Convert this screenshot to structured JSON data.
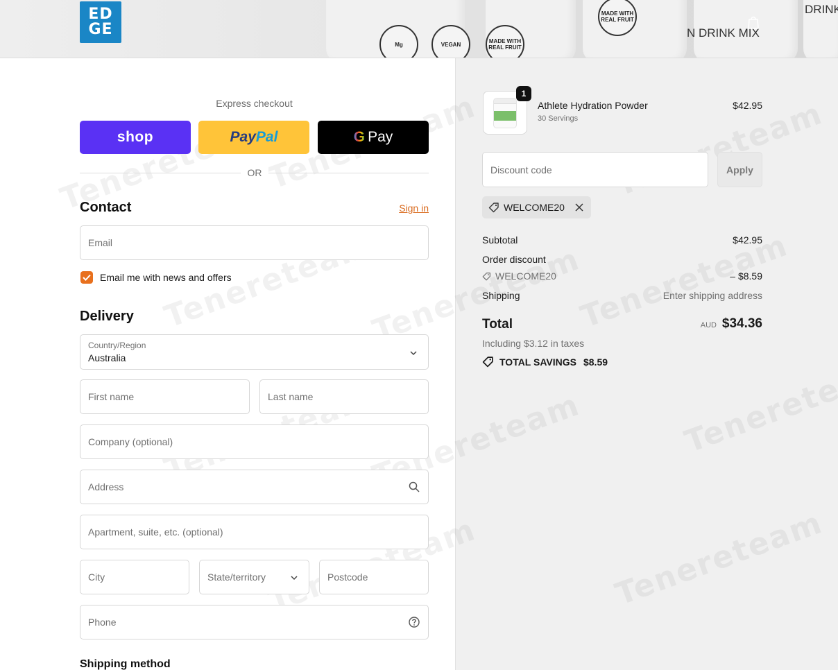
{
  "header": {
    "logo_top": "ED",
    "logo_bottom": "GE",
    "banner_texts": [
      "N DRINK MIX",
      "DRINK"
    ],
    "banner_badges": [
      "Mg",
      "VEGAN",
      "MADE WITH REAL FRUIT"
    ],
    "cart_icon": "shopping-bag-icon"
  },
  "express": {
    "label": "Express checkout",
    "shop_label": "shop",
    "paypal_part1": "Pay",
    "paypal_part2": "Pal",
    "gpay_g": "G",
    "gpay_label": "Pay",
    "or_label": "OR"
  },
  "contact": {
    "title": "Contact",
    "sign_in": "Sign in",
    "email_placeholder": "Email",
    "newsletter_label": "Email me with news and offers",
    "newsletter_checked": true
  },
  "delivery": {
    "title": "Delivery",
    "country_label": "Country/Region",
    "country_value": "Australia",
    "first_name_placeholder": "First name",
    "last_name_placeholder": "Last name",
    "company_placeholder": "Company (optional)",
    "address_placeholder": "Address",
    "apartment_placeholder": "Apartment, suite, etc. (optional)",
    "city_placeholder": "City",
    "state_label": "State/territory",
    "postcode_placeholder": "Postcode",
    "phone_placeholder": "Phone"
  },
  "shipping_method": {
    "title": "Shipping method"
  },
  "order": {
    "product_name": "Athlete Hydration Powder",
    "product_variant": "30 Servings",
    "product_price": "$42.95",
    "quantity": "1",
    "discount_placeholder": "Discount code",
    "apply_label": "Apply",
    "applied_code": "WELCOME20",
    "subtotal_label": "Subtotal",
    "subtotal_value": "$42.95",
    "order_discount_label": "Order discount",
    "discount_code": "WELCOME20",
    "discount_value": "– $8.59",
    "shipping_label": "Shipping",
    "shipping_value": "Enter shipping address",
    "total_label": "Total",
    "currency": "AUD",
    "total_value": "$34.36",
    "taxes_text": "Including $3.12 in taxes",
    "savings_label": "TOTAL SAVINGS",
    "savings_value": "$8.59"
  },
  "watermark": "Tenereteam",
  "colors": {
    "accent": "#e8701d",
    "shop_purple": "#5a31f4",
    "paypal_yellow": "#ffc439",
    "logo_blue": "#1a86c6"
  }
}
